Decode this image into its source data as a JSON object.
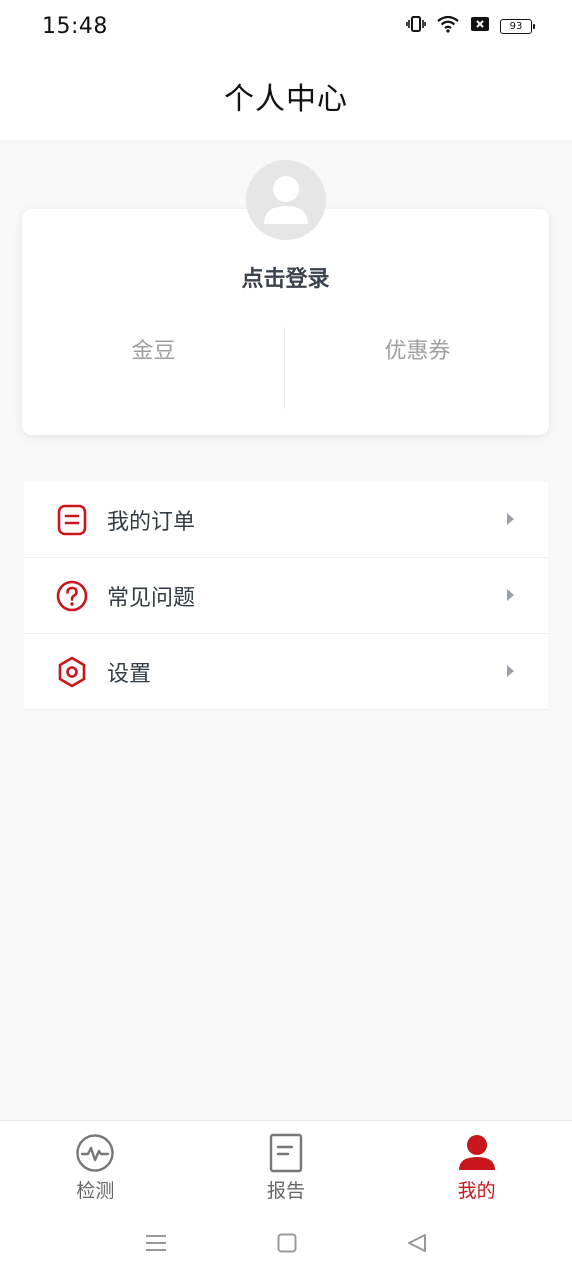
{
  "status_bar": {
    "time": "15:48",
    "battery": "93",
    "icons": [
      "vibrate-icon",
      "wifi-icon",
      "no-sim-icon",
      "battery-icon"
    ]
  },
  "header": {
    "title": "个人中心"
  },
  "profile": {
    "login_label": "点击登录",
    "stats": [
      {
        "label": "金豆"
      },
      {
        "label": "优惠券"
      }
    ]
  },
  "menu": {
    "items": [
      {
        "label": "我的订单",
        "icon": "order-icon"
      },
      {
        "label": "常见问题",
        "icon": "question-icon"
      },
      {
        "label": "设置",
        "icon": "settings-icon"
      }
    ]
  },
  "tab_bar": {
    "items": [
      {
        "label": "检测",
        "icon": "pulse-icon",
        "active": false
      },
      {
        "label": "报告",
        "icon": "report-icon",
        "active": false
      },
      {
        "label": "我的",
        "icon": "user-icon",
        "active": true
      }
    ]
  },
  "colors": {
    "accent": "#c8161d",
    "background": "#f8f8f8",
    "text_dark": "#333c46",
    "text_muted": "#a0a0a0"
  }
}
